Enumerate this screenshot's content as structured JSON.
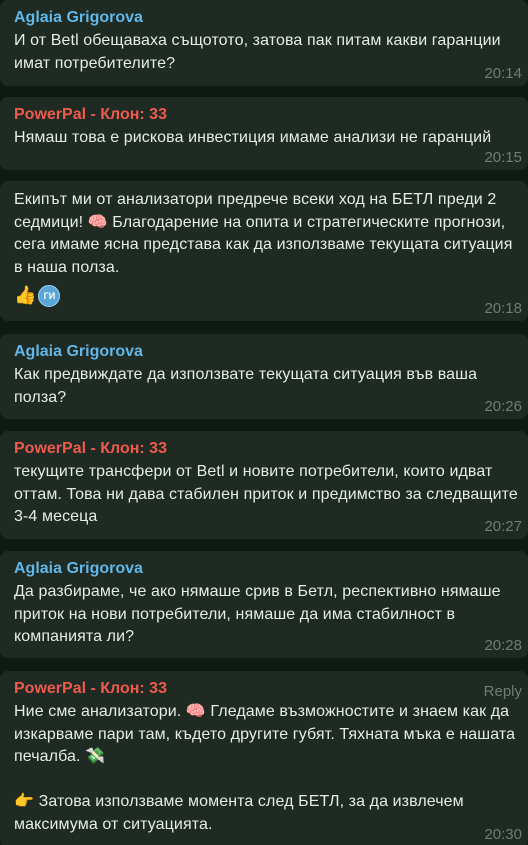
{
  "colors": {
    "background": "#0e1a12",
    "bubble": "#1e2a22",
    "sender_aglaia": "#62b7e8",
    "sender_powerpal": "#ef5a4e",
    "text": "#e6ece8",
    "meta": "#6f7d74"
  },
  "messages": [
    {
      "sender": "Aglaia Grigorova",
      "text": "И от Betl обещаваха същотото, затова пак питам какви гаранции имат потребителите?",
      "time": "20:14"
    },
    {
      "sender": "PowerPal - Клон: 33",
      "text": "Нямаш това е рискова инвестиция имаме анализи не гаранций",
      "time": "20:15"
    },
    {
      "sender": "",
      "text": "Екипът ми от анализатори предрече всеки ход на БЕТЛ преди 2 седмици! 🧠 Благодарение на опита и стратегическите прогнози, сега имаме ясна представа как да използваме текущата ситуация в наша полза.",
      "time": "20:18",
      "reactions": {
        "emoji": "👍",
        "avatar_initials": "ГИ"
      }
    },
    {
      "sender": "Aglaia Grigorova",
      "text": "Как предвиждате да използвате текущата ситуация във ваша полза?",
      "time": "20:26"
    },
    {
      "sender": "PowerPal - Клон: 33",
      "text": "текущите трансфери от Betl и новите потребители, които идват оттам. Това ни дава стабилен приток и предимство за следващите 3-4 месеца",
      "time": "20:27"
    },
    {
      "sender": "Aglaia Grigorova",
      "text": "Да разбираме, че ако нямаше срив в Бетл, респективно нямаше приток на нови потребители, нямаше да има стабилност в компанията ли?",
      "time": "20:28"
    },
    {
      "sender": "PowerPal - Клон: 33",
      "text": "Ние сме анализатори. 🧠 Гледаме възможностите и знаем как да изкарваме пари там, където другите губят. Тяхната мъка е нашата печалба. 💸\n\n👉 Затова използваме момента след БЕТЛ, за да извлечем максимума от ситуацията.",
      "time": "20:30",
      "reply_label": "Reply"
    }
  ]
}
